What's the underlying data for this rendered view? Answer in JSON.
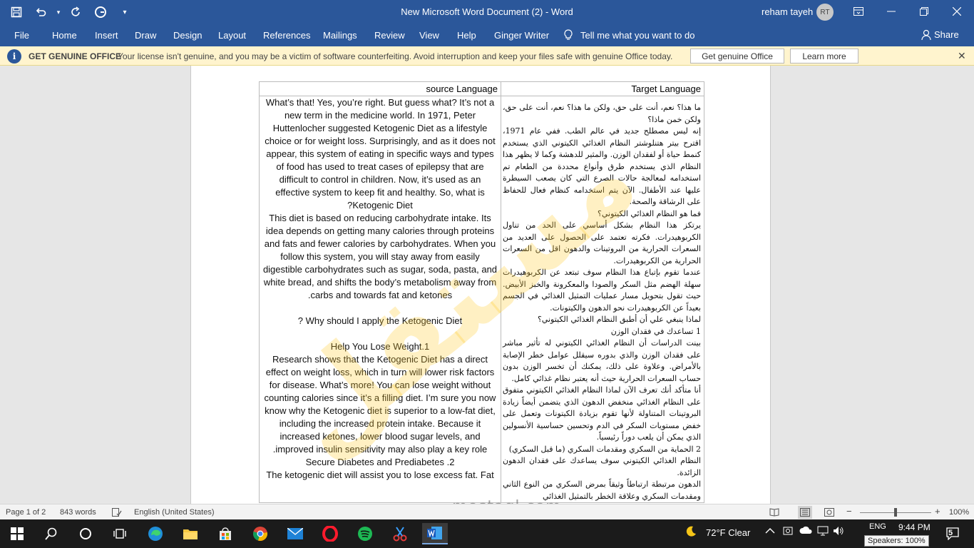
{
  "window": {
    "title": "New Microsoft Word Document (2)  -  Word",
    "user_name": "reham tayeh",
    "user_initials": "RT"
  },
  "ribbon": {
    "tabs": [
      "File",
      "Home",
      "Insert",
      "Draw",
      "Design",
      "Layout",
      "References",
      "Mailings",
      "Review",
      "View",
      "Help",
      "Ginger Writer"
    ],
    "tell_me": "Tell me what you want to do",
    "share": "Share"
  },
  "infobar": {
    "title": "GET GENUINE OFFICE",
    "message": "Your license isn't genuine, and you may be a victim of software counterfeiting. Avoid interruption and keep your files safe with genuine Office today.",
    "primary_button": "Get genuine Office",
    "secondary_button": "Learn more"
  },
  "table": {
    "header_source": "source Language",
    "header_target": "Target Language",
    "source_paragraphs": [
      "What’s that! Yes, you’re right. But guess what? It’s not a new term in the medicine world. In 1971, Peter Huttenlocher suggested Ketogenic Diet as a lifestyle choice or for weight loss. Surprisingly, and as it does not appear, this system of eating in specific ways and types of food has used to treat cases of epilepsy that are difficult to control in children. Now, it’s used as an effective system to keep fit and healthy. So, what is Ketogenic Diet?",
      "This diet is based on reducing carbohydrate intake. Its idea depends on getting many calories through proteins and fats and fewer calories by carbohydrates. When you follow this system, you will stay away from easily digestible carbohydrates such as sugar, soda, pasta, and white bread, and shifts the body’s metabolism away from carbs and towards fat and ketones.",
      "",
      "Why should I apply the Ketogenic Diet ?",
      "",
      "Help You Lose Weight.1",
      "Research shows that the Ketogenic Diet has a direct effect on weight loss, which in turn will lower risk factors for disease. What’s more! You can lose weight without counting calories since it’s a filling diet. I’m sure you now know why the Ketogenic diet is superior to a low-fat diet, including the increased protein intake. Because it increased ketones, lower blood sugar levels, and improved insulin sensitivity may also play a key role.",
      "Secure Diabetes and Prediabetes .2",
      "The ketogenic diet will assist you to lose excess fat. Fat"
    ],
    "target_paragraphs": [
      "ما هذا؟ نعم، أنت على حق، ولكن ما هذا؟ نعم، أنت على حق، ولكن خمن ماذا؟",
      "إنه ليس مصطلح جديد في عالم الطب. ففي عام 1971، اقترح بيتر هتنلوشتر النظام الغذائي الكيتوني الذي يستخدم كنمط حياة أو لفقدان الوزن. والمثير للدهشة وكما لا يظهر هذا النظام الذي يستخدم طرق وأنواع محددة من الطعام تم استخدامه لمعالجة حالات الصرع التي كان يصعب السيطرة عليها عند الأطفال. الآن يتم استخدامه كنظام فعال للحفاظ على الرشاقة والصحة.",
      "فما هو النظام الغذائي الكيتوني؟",
      "يرتكز هذا النظام بشكل أساسي على الحد من تناول الكربوهيدرات. فكرته تعتمد على الحصول على العديد من السعرات الحرارية من البروتينات والدهون اقل من السعرات الحرارية من الكربوهيدرات.",
      "عندما تقوم بإتباع هذا النظام سوف تبتعد عن الكربوهيدرات سهلة الهضم مثل السكر والصودا والمعكرونة والخبز الأبيض. حيث تقول بتحويل مسار عمليات التمثيل الغذائي في الجسم بعيداً عن الكربوهيدرات نحو الدهون والكيتونات.",
      "لماذا ينبغي علي أن أطبق النظام الغذائي الكيتوني؟",
      "1 تساعدك في فقدان الوزن",
      "بينت الدراسات أن النظام الغذائي الكيتوني له تأثير مباشر على فقدان الوزن والذي بدوره سيقلل عوامل خطر الإصابة بالأمراض. وعلاوة على ذلك، يمكنك أن تخسر الوزن بدون حساب السعرات الحرارية حيث أنه يعتبر نظام غذائي كامل.",
      "أنا متأكد أنك تعرف الآن لماذا النظام الغذائي الكيتوني متفوق على النظام الغذائي منخفض الدهون الذي يتضمن أيضاً زيادة البروتينات المتناولة لأنها تقوم بزيادة الكيتونات وتعمل على خفض مستويات السكر في الدم وتحسين حساسية الأنسولين الذي يمكن أن يلعب دوراً رئيسياً.",
      "2 الحماية من السكري ومقدمات السكري (ما قبل السكري)",
      "النظام الغذائي الكيتوني سوف يساعدك على فقدان الدهون الزائدة.",
      "الدهون مرتبطة ارتباطاً وثيقاً بمرض السكري من النوع الثاني ومقدمات السكري وعلاقة الخطر بالتمثيل الغذائي"
    ]
  },
  "watermark": {
    "site": "mostaql.com"
  },
  "statusbar": {
    "page": "Page 1 of 2",
    "words": "843 words",
    "language": "English (United States)",
    "zoom": "100%",
    "zoom_level": 0.5
  },
  "taskbar": {
    "weather": "72°F  Clear",
    "time": "9:44 PM",
    "speakers_tooltip": "Speakers: 100%",
    "lang": "ENG",
    "notification_count": "5"
  },
  "colors": {
    "word_blue": "#2b579a",
    "info_bar": "#fff4ce",
    "watermark": "#ffc828"
  }
}
